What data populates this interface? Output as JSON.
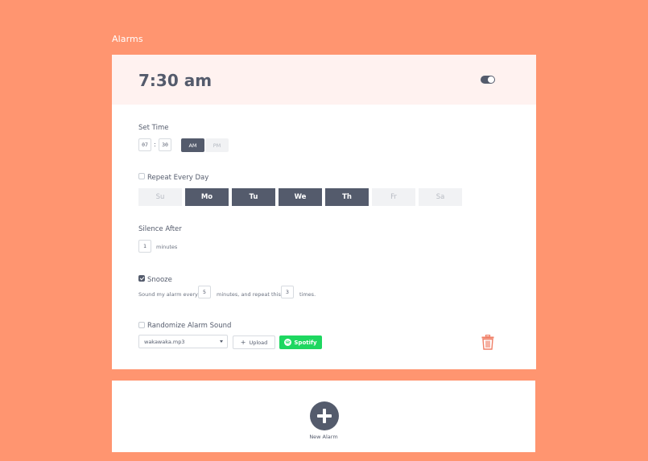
{
  "page": {
    "title": "Alarms"
  },
  "alarm": {
    "time_display": "7:30 am",
    "enabled": true,
    "set_time_label": "Set Time",
    "hour": "07",
    "separator": ":",
    "minute": "30",
    "am_label": "AM",
    "pm_label": "PM",
    "period_selected": "AM",
    "repeat_label": "Repeat Every Day",
    "repeat_checked": false,
    "days": [
      {
        "label": "Su",
        "on": false
      },
      {
        "label": "Mo",
        "on": true
      },
      {
        "label": "Tu",
        "on": true
      },
      {
        "label": "We",
        "on": true
      },
      {
        "label": "Th",
        "on": true
      },
      {
        "label": "Fr",
        "on": false
      },
      {
        "label": "Sa",
        "on": false
      }
    ],
    "silence_label": "Silence After",
    "silence_value": "1",
    "silence_unit": "minutes",
    "snooze_label": "Snooze",
    "snooze_checked": true,
    "snooze_text_1": "Sound my alarm every",
    "snooze_minutes": "5",
    "snooze_text_2": "minutes, and repeat this",
    "snooze_repeat": "3",
    "snooze_text_3": "times.",
    "randomize_label": "Randomize Alarm Sound",
    "randomize_checked": false,
    "sound_file": "wakawaka.mp3",
    "upload_label": "Upload",
    "spotify_label": "Spotify"
  },
  "new_alarm": {
    "label": "New Alarm"
  },
  "colors": {
    "background": "#FF9570",
    "primary": "#545B6C",
    "header_tint": "#FFF2F0",
    "spotify": "#1ED760",
    "trash": "#F07F66"
  },
  "icons": {
    "toggle": "toggle-on-icon",
    "plus": "plus-icon",
    "spotify": "spotify-icon",
    "trash": "trash-icon",
    "caret": "chevron-down-icon"
  }
}
